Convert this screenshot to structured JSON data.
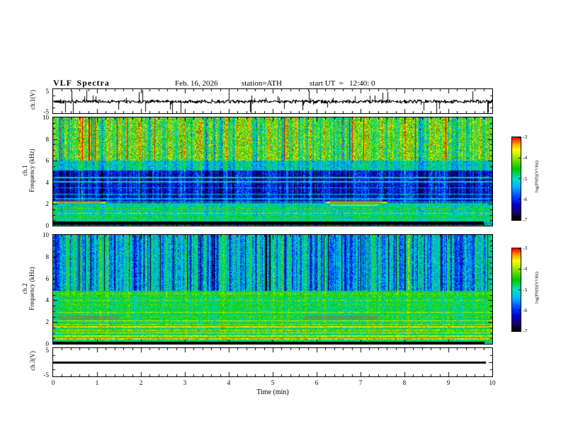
{
  "header": {
    "title": "VLF Spectra",
    "date": "Feb. 16, 2026",
    "station": "station=ATH",
    "start_ut": "start UT  =   12:40: 0"
  },
  "xaxis": {
    "label": "Time  (min)",
    "range": [
      0,
      10
    ],
    "ticks": [
      0,
      1,
      2,
      3,
      4,
      5,
      6,
      7,
      8,
      9,
      10
    ]
  },
  "colormap": {
    "range": [
      -7,
      -3
    ],
    "stops": [
      {
        "t": 0.0,
        "c": "#000000"
      },
      {
        "t": 0.08,
        "c": "#1a0060"
      },
      {
        "t": 0.18,
        "c": "#0000cc"
      },
      {
        "t": 0.28,
        "c": "#0044ff"
      },
      {
        "t": 0.4,
        "c": "#00b4ff"
      },
      {
        "t": 0.5,
        "c": "#00e0c0"
      },
      {
        "t": 0.62,
        "c": "#00c800"
      },
      {
        "t": 0.75,
        "c": "#96e400"
      },
      {
        "t": 0.85,
        "c": "#ffff00"
      },
      {
        "t": 0.93,
        "c": "#ff9600"
      },
      {
        "t": 1.0,
        "c": "#ff0000"
      }
    ]
  },
  "chart_data": [
    {
      "type": "line",
      "name": "ch1_waveform",
      "ylabel": "ch.1(V)",
      "ylim": [
        -5,
        5
      ],
      "yticks": [
        5,
        -5
      ],
      "signal": {
        "description": "broadband VLF noise of ~±0.6 V with frequent impulsive sferic spikes reaching ±5 V across the full 10 min record",
        "noise_amp_v": 0.55,
        "spike_rate": 0.13,
        "spike_max_v": 5
      }
    },
    {
      "type": "heatmap",
      "name": "ch1_spectrogram",
      "ylabel_lines": [
        "ch.1",
        "Frequency  (kHz)"
      ],
      "ylim": [
        0,
        10
      ],
      "yticks": [
        0,
        2,
        4,
        6,
        8,
        10
      ],
      "xlim": [
        0,
        10
      ],
      "colorbar": {
        "label": "log(PSD)(V²/Hz)",
        "range": [
          -7,
          -3
        ],
        "ticks": [
          -3,
          -4,
          -5,
          -6,
          -7
        ]
      },
      "regions": [
        {
          "fmin": 6.0,
          "fmax": 10.1,
          "base": -4.35,
          "noise": 0.85,
          "streak": 1.5,
          "redstreak": true
        },
        {
          "fmin": 5.1,
          "fmax": 6.0,
          "base": -5.1,
          "noise": 0.6,
          "streak": 0.9
        },
        {
          "fmin": 2.1,
          "fmax": 5.1,
          "base": -6.15,
          "noise": 0.5,
          "streak": 0.9,
          "darkstreak": true
        },
        {
          "fmin": 0.9,
          "fmax": 2.1,
          "base": -5.0,
          "noise": 0.55,
          "streak": 0.5
        },
        {
          "fmin": 0.42,
          "fmax": 0.9,
          "base": -4.9,
          "noise": 0.5,
          "streak": 0.4
        },
        {
          "fmin": 0.08,
          "fmax": 0.42,
          "black": true,
          "base": -5.2,
          "noise": 0.8,
          "streak": 0
        },
        {
          "fmin": -1,
          "fmax": 0.08,
          "base": -5.1,
          "noise": 1.0,
          "streak": 0
        }
      ],
      "hlines": [
        {
          "f": 4.45,
          "v": -4.9
        },
        {
          "f": 4.05,
          "v": -5.2
        },
        {
          "f": 3.5,
          "v": -5.5
        },
        {
          "f": 2.9,
          "v": -5.1
        },
        {
          "f": 2.5,
          "v": -5.4
        },
        {
          "f": 2.2,
          "v": -5.0
        },
        {
          "f": 1.6,
          "v": -4.4
        },
        {
          "f": 1.15,
          "v": -4.1
        },
        {
          "f": 0.8,
          "v": -4.5
        }
      ],
      "segments": [
        {
          "f": 2.15,
          "v": -3.7,
          "x0": 0,
          "x1": 1.2
        },
        {
          "f": 2.15,
          "v": -3.7,
          "x0": 6.2,
          "x1": 7.6
        },
        {
          "f": 1.9,
          "v": -4.0,
          "x0": 6.3,
          "x1": 7.4
        }
      ],
      "gray": [
        {
          "f0": 2.05,
          "f1": 2.35,
          "x0": 0.1,
          "x1": 1.1
        },
        {
          "f0": 2.05,
          "f1": 2.4,
          "x0": 6.3,
          "x1": 7.5
        }
      ]
    },
    {
      "type": "heatmap",
      "name": "ch2_spectrogram",
      "ylabel_lines": [
        "ch.2",
        "Frequency  (kHz)"
      ],
      "ylim": [
        0,
        10
      ],
      "yticks": [
        0,
        2,
        4,
        6,
        8,
        10
      ],
      "xlim": [
        0,
        10
      ],
      "colorbar": {
        "label": "log(PSD)(V²/Hz)",
        "range": [
          -7,
          -3
        ],
        "ticks": [
          -3,
          -4,
          -5,
          -6,
          -7
        ]
      },
      "regions": [
        {
          "fmin": 4.9,
          "fmax": 10.1,
          "base": -5.35,
          "noise": 0.55,
          "streak": 1.6,
          "darkstreak": true
        },
        {
          "fmin": 4.3,
          "fmax": 4.9,
          "base": -4.55,
          "noise": 0.4,
          "streak": 0.5
        },
        {
          "fmin": 0.18,
          "fmax": 4.3,
          "base": -4.7,
          "noise": 0.45,
          "streak": 0.55
        },
        {
          "fmin": -1,
          "fmax": 0.18,
          "black": true,
          "base": -5.0,
          "noise": 0.8,
          "streak": 0
        }
      ],
      "hlines": [
        {
          "f": 4.6,
          "v": -4.25
        },
        {
          "f": 4.0,
          "v": -4.15
        },
        {
          "f": 3.6,
          "v": -4.35
        },
        {
          "f": 3.15,
          "v": -4.5
        },
        {
          "f": 2.9,
          "v": -3.95
        },
        {
          "f": 2.45,
          "v": -4.35
        },
        {
          "f": 2.1,
          "v": -3.8
        },
        {
          "f": 1.8,
          "v": -4.05
        },
        {
          "f": 1.55,
          "v": -3.55
        },
        {
          "f": 1.25,
          "v": -4.1
        },
        {
          "f": 1.0,
          "v": -3.65
        },
        {
          "f": 0.7,
          "v": -3.85
        },
        {
          "f": 0.45,
          "v": -3.45
        }
      ],
      "segments": [],
      "gray": [
        {
          "f0": 2.2,
          "f1": 2.6,
          "x0": 0.15,
          "x1": 1.5
        },
        {
          "f0": 2.2,
          "f1": 2.6,
          "x0": 5.7,
          "x1": 7.4
        }
      ]
    },
    {
      "type": "line",
      "name": "ch3_waveform",
      "ylabel": "ch.3(V)",
      "ylim": [
        -5,
        5
      ],
      "yticks": [
        5,
        -5
      ],
      "signal": {
        "description": "flat line at 0 V (dead channel), thick black trace ending near 9.85 min",
        "value_v": 0,
        "end_min": 9.85
      }
    }
  ]
}
